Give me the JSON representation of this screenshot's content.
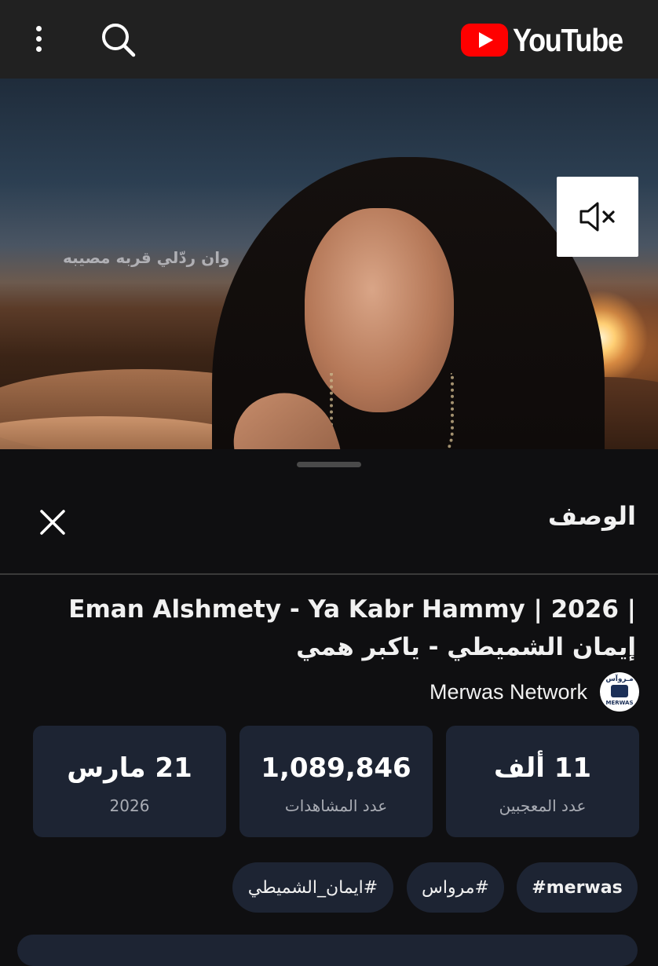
{
  "header": {
    "logo_text": "YouTube",
    "brand_color": "#ff0000",
    "icons": [
      "more-vert-icon",
      "search-icon"
    ]
  },
  "video": {
    "lyric_overlay": "وان ردّلي قربه مصيبه",
    "mute_icon": "volume-off-icon"
  },
  "description_panel": {
    "title": "الوصف",
    "close_icon": "close-icon",
    "video_title_line1": "Eman Alshmety - Ya Kabr Hammy | 2026 |",
    "video_title_line2": "إيمان الشميطي - ياكبر همي",
    "channel": {
      "name": "Merwas Network",
      "avatar_text_top": "مـروآس",
      "avatar_text_bottom": "MERWAS"
    },
    "stats": [
      {
        "value": "11 ألف",
        "label": "عدد المعجبين"
      },
      {
        "value": "1,089,846",
        "label": "عدد المشاهدات"
      },
      {
        "value": "21 مارس",
        "label": "2026"
      }
    ],
    "hashtags": [
      "#merwas",
      "#مرواس",
      "#ايمان_الشميطي"
    ]
  },
  "colors": {
    "background": "#0f0f11",
    "topbar": "#212121",
    "card": "#1d2433",
    "secondary_text": "#a9acb4"
  }
}
